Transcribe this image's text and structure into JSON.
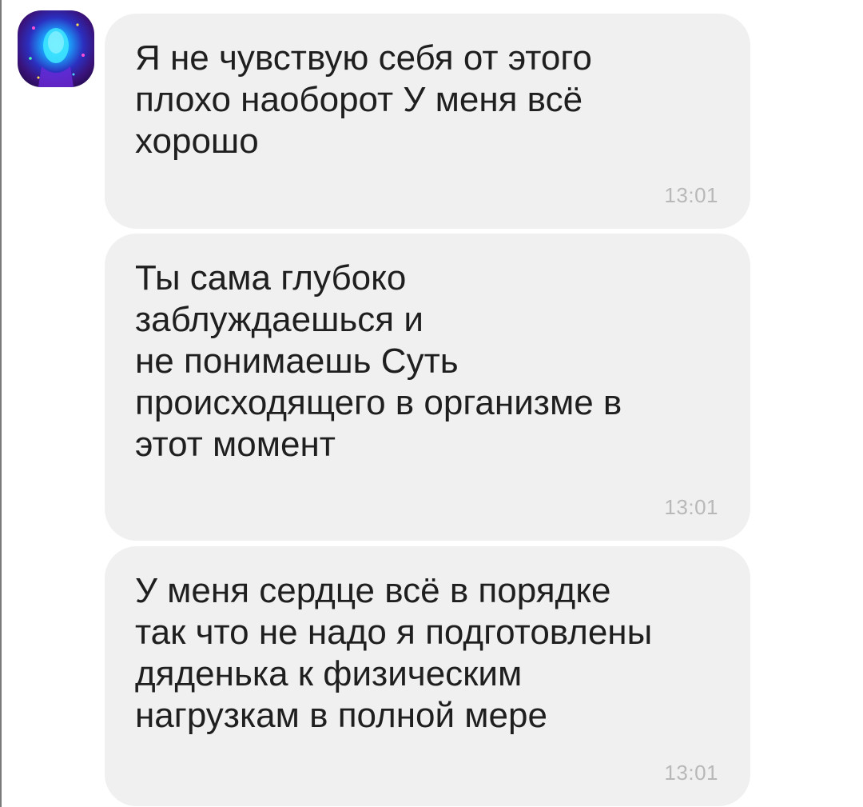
{
  "chat": {
    "avatar_icon": "user-avatar-icon",
    "colors": {
      "bubble_background": "#f0f0f0",
      "text": "#1f1f1f",
      "timestamp": "#b8b8b8",
      "avatar_accent": "#1fe3ff"
    },
    "messages": [
      {
        "text": "Я не чувствую себя от этого\nплохо наоборот У меня всё\nхорошо",
        "time": "13:01"
      },
      {
        "text": "Ты сама глубоко\nзаблуждаешься и\nне понимаешь Суть\nпроисходящего в организме в\nэтот момент",
        "time": "13:01"
      },
      {
        "text": "У меня сердце всё в порядке\nтак что не надо я подготовлены\nдяденька к физическим\nнагрузкам в полной мере",
        "time": "13:01"
      }
    ]
  }
}
